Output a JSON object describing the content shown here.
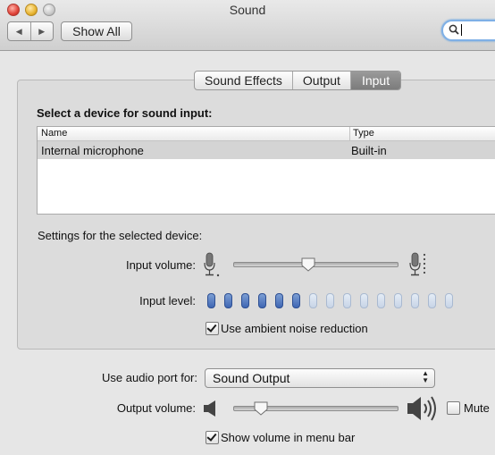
{
  "window": {
    "title": "Sound"
  },
  "toolbar": {
    "back_icon": "◀",
    "forward_icon": "▶",
    "show_all_label": "Show All"
  },
  "tabs": [
    {
      "label": "Sound Effects",
      "active": false
    },
    {
      "label": "Output",
      "active": false
    },
    {
      "label": "Input",
      "active": true
    }
  ],
  "input_panel": {
    "select_label": "Select a device for sound input:",
    "table": {
      "columns": [
        "Name",
        "Type"
      ],
      "rows": [
        {
          "name": "Internal microphone",
          "type": "Built-in",
          "selected": true
        }
      ]
    },
    "settings_label": "Settings for the selected device:",
    "input_volume_label": "Input volume:",
    "input_volume_value": 0.46,
    "input_level_label": "Input level:",
    "input_level_active_segments": 6,
    "input_level_total_segments": 15,
    "ambient_noise_label": "Use ambient noise reduction",
    "ambient_noise_checked": true
  },
  "bottom": {
    "audio_port_label": "Use audio port for:",
    "audio_port_value": "Sound Output",
    "output_volume_label": "Output volume:",
    "output_volume_value": 0.17,
    "mute_label": "Mute",
    "mute_checked": false,
    "show_volume_label": "Show volume in menu bar",
    "show_volume_checked": true
  }
}
